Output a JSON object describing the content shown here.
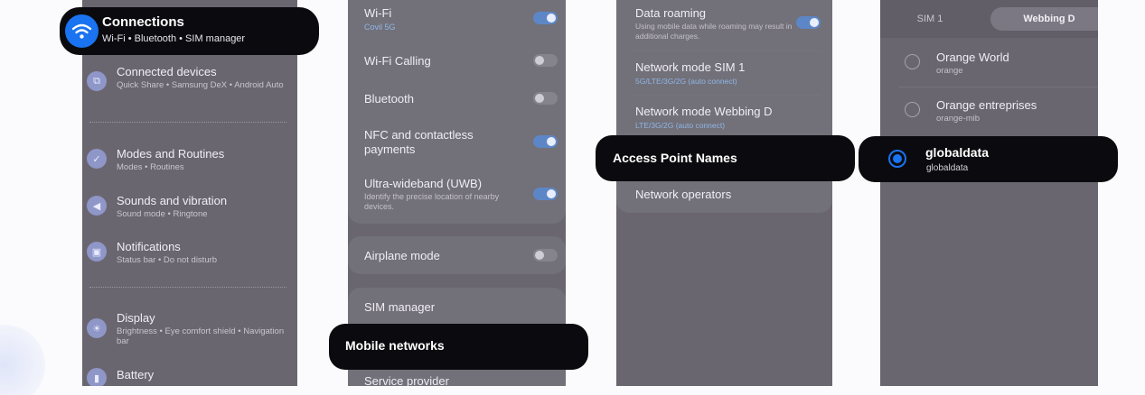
{
  "settings_main": {
    "connections": {
      "title": "Connections",
      "subtitle": "Wi-Fi  •  Bluetooth  •  SIM manager"
    },
    "items": [
      {
        "title": "Connected devices",
        "subtitle": "Quick Share  •  Samsung DeX  •  Android Auto",
        "icon": "link-icon"
      },
      {
        "title": "Modes and Routines",
        "subtitle": "Modes  •  Routines",
        "icon": "check-circle-icon"
      },
      {
        "title": "Sounds and vibration",
        "subtitle": "Sound mode  •  Ringtone",
        "icon": "speaker-icon"
      },
      {
        "title": "Notifications",
        "subtitle": "Status bar  •  Do not disturb",
        "icon": "bell-icon"
      },
      {
        "title": "Display",
        "subtitle": "Brightness  •  Eye comfort shield  •  Navigation bar",
        "icon": "sun-icon"
      },
      {
        "title": "Battery",
        "subtitle": "",
        "icon": "battery-icon"
      }
    ]
  },
  "connections_menu": {
    "wifi": {
      "title": "Wi-Fi",
      "subtitle": "Covil 5G",
      "on": true
    },
    "wifi_calling": {
      "title": "Wi-Fi Calling",
      "on": false
    },
    "bluetooth": {
      "title": "Bluetooth",
      "on": false
    },
    "nfc": {
      "title": "NFC and contactless payments",
      "on": true
    },
    "uwb": {
      "title": "Ultra-wideband (UWB)",
      "subtitle": "Identify the precise location of nearby devices.",
      "on": true
    },
    "airplane": {
      "title": "Airplane mode",
      "on": false
    },
    "sim_manager": {
      "title": "SIM manager"
    },
    "mobile_networks": {
      "title": "Mobile networks"
    },
    "service_provider": {
      "title": "Service provider"
    }
  },
  "mobile_networks": {
    "data_roaming": {
      "title": "Data roaming",
      "subtitle": "Using mobile data while roaming may result in additional charges.",
      "on": true
    },
    "network_mode_sim1": {
      "title": "Network mode SIM 1",
      "subtitle": "5G/LTE/3G/2G (auto connect)"
    },
    "network_mode_webbing": {
      "title": "Network mode Webbing D",
      "subtitle": "LTE/3G/2G (auto connect)"
    },
    "apn": {
      "title": "Access Point Names"
    },
    "operators": {
      "title": "Network operators"
    }
  },
  "apn_list": {
    "tabs": [
      "SIM 1",
      "Webbing D"
    ],
    "entries": [
      {
        "name": "Orange World",
        "apn": "orange",
        "selected": false
      },
      {
        "name": "Orange entreprises",
        "apn": "orange-mib",
        "selected": false
      },
      {
        "name": "globaldata",
        "apn": "globaldata",
        "selected": true
      }
    ]
  },
  "colors": {
    "panel": "#6a6670",
    "callout": "#0b0b0f",
    "accent_blue": "#1a73f0",
    "toggle_on": "#5d86c7"
  }
}
